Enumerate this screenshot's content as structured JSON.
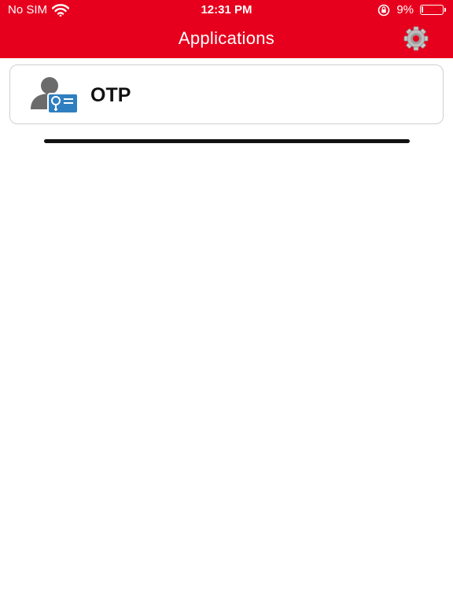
{
  "status_bar": {
    "carrier": "No SIM",
    "time": "12:31 PM",
    "battery_percent": "9%",
    "battery_level": 0.09,
    "icons": [
      "wifi-icon",
      "orientation-lock-icon",
      "battery-icon"
    ]
  },
  "header": {
    "title": "Applications",
    "settings_icon": "gear-icon"
  },
  "apps": [
    {
      "label": "OTP",
      "icon": "user-badge-icon"
    }
  ],
  "colors": {
    "header_bg": "#e7001d",
    "header_text": "#ffffff",
    "card_border": "#cfcfcf",
    "icon_blue": "#2f7fc0",
    "icon_gray": "#6b6b6b"
  }
}
